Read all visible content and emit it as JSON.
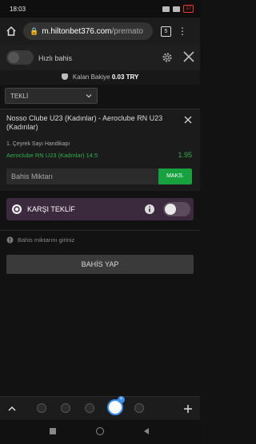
{
  "status_bar": {
    "time": "18:03",
    "battery": "17"
  },
  "browser": {
    "url_main": "m.hiltonbet376.com",
    "url_rest": "/premato",
    "tab_count": "5"
  },
  "top_bar": {
    "quick_bet_label": "Hızlı bahis"
  },
  "balance": {
    "label": "Kalan Bakiye",
    "value": "0.03 TRY"
  },
  "bet_type_select": {
    "selected": "TEKLİ"
  },
  "bet": {
    "match": "Nosso Clube U23 (Kadınlar) - Aeroclube RN U23 (Kadınlar)",
    "market": "1. Çeyrek Sayı Handikapı",
    "selection": "Aeroclube RN U23 (Kadınlar) 14.5",
    "odds": "1.95",
    "stake_placeholder": "Bahis Miktarı",
    "max_label": "MAKS."
  },
  "counter_offer": {
    "label": "KARŞI TEKLİF"
  },
  "warning": {
    "text": "Bahis miktarını giriniz"
  },
  "place_bet": {
    "label": "BAHİS YAP"
  },
  "colors": {
    "accent_green": "#17a23f",
    "odds_green": "#2eb04f",
    "counter_bg": "#3b2a3d"
  }
}
